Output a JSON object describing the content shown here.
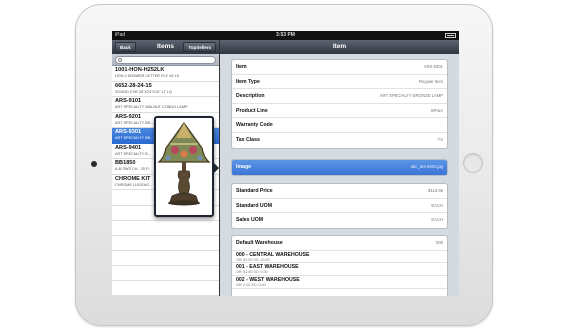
{
  "status": {
    "carrier": "iPad",
    "time": "3:53 PM",
    "battery_pct": 0.7
  },
  "master": {
    "back_label": "Back",
    "title": "Items",
    "top_sellers_label": "TopSellers",
    "search_placeholder": "",
    "items": [
      {
        "title": "1001-HON-H252LK",
        "subtitle": "HON 2 DRAWER LETTER FLE W/ LK",
        "selected": false
      },
      {
        "title": "6652-28-24-15",
        "subtitle": "SOUND CVR 28\"X24\"X15\" LT LQ",
        "selected": false
      },
      {
        "title": "ARS-9101",
        "subtitle": "ART SPECIALTY WALNUT CONDO LAMP",
        "selected": false
      },
      {
        "title": "ARS-9201",
        "subtitle": "ART SPECIALTY BR...",
        "selected": false
      },
      {
        "title": "ARS-9301",
        "subtitle": "ART SPECIALTY BR...",
        "selected": true
      },
      {
        "title": "ARS-9401",
        "subtitle": "ART SPECIALTY B...",
        "selected": false
      },
      {
        "title": "BB1850",
        "subtitle": "A-B SWITCH - 25 P...",
        "selected": false
      },
      {
        "title": "CHROME KIT",
        "subtitle": "CHROME LUGGAG...",
        "selected": false
      }
    ]
  },
  "detail": {
    "title": "Item",
    "fields": [
      {
        "label": "Item",
        "value": "ARS-9301"
      },
      {
        "label": "Item Type",
        "value": "Regular Item"
      },
      {
        "label": "Description",
        "value": "ART SPECIALTY BRONZE LAMP"
      },
      {
        "label": "Product Line",
        "value": "WF&A"
      },
      {
        "label": "Warranty Code",
        "value": ""
      },
      {
        "label": "Tax Class",
        "value": "TX"
      }
    ],
    "image": {
      "label": "Image",
      "value": "abc_ars-9301.jpg"
    },
    "pricing": [
      {
        "label": "Standard Price",
        "value": "$119.95"
      },
      {
        "label": "Standard UOM",
        "value": "EACH"
      },
      {
        "label": "Sales UOM",
        "value": "EACH"
      }
    ],
    "warehouses": {
      "label": "Default Warehouse",
      "value": "000",
      "items": [
        {
          "title": "000 - CENTRAL WAREHOUSE",
          "subtitle": "OH: 81.00 SO: 20.00"
        },
        {
          "title": "001 - EAST WAREHOUSE",
          "subtitle": "OH: 81.00 SO: 0.00"
        },
        {
          "title": "002 - WEST WAREHOUSE",
          "subtitle": "OH: 0.00 SO: 0.00"
        }
      ]
    }
  },
  "popover": {
    "content": "tiffany-lamp-image"
  },
  "colors": {
    "selection_blue": "#2a6bd2",
    "nav_dark": "#2f3540",
    "detail_bg": "#d5d9e0"
  }
}
